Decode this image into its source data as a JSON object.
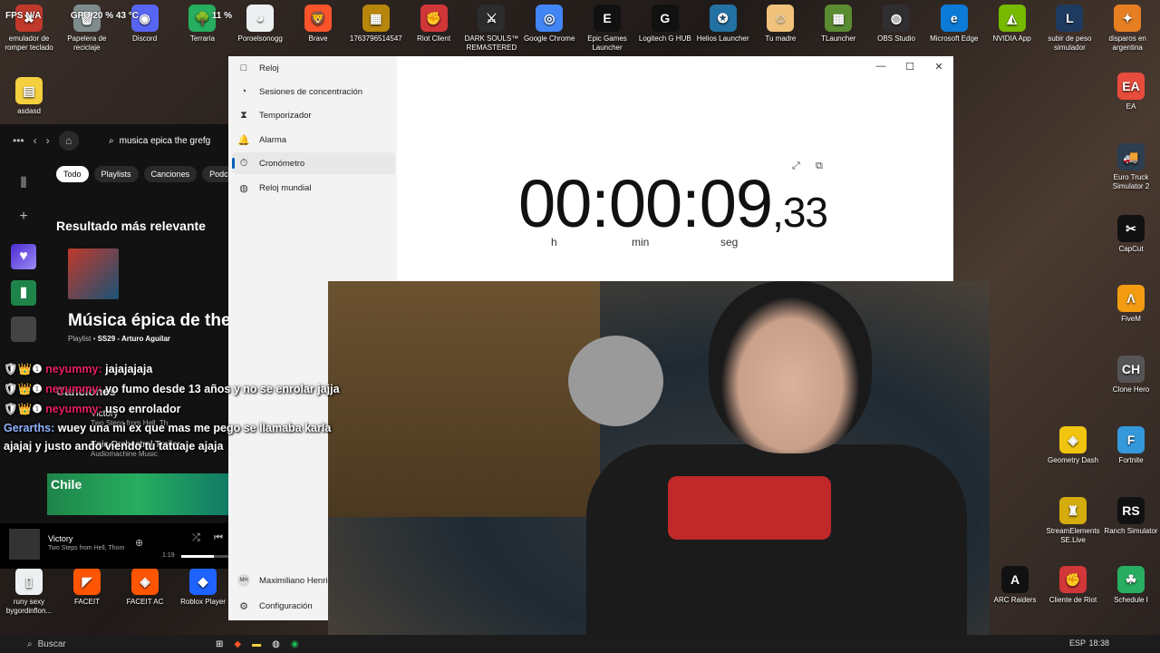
{
  "hud": {
    "fps": "FPS N/A",
    "gpu": "GPU",
    "gpu_load": "20 %",
    "gpu_temp": "43 °C",
    "extra": "11 %"
  },
  "desktop_top": [
    {
      "label": "emulador de romper teclado",
      "color": "#c0392b",
      "glyph": "✖"
    },
    {
      "label": "Papelera de reciclaje",
      "color": "#7f8c8d",
      "glyph": "🗑"
    },
    {
      "label": "Discord",
      "color": "#5865f2",
      "glyph": "◉"
    },
    {
      "label": "Terraria",
      "color": "#27ae60",
      "glyph": "🌳"
    },
    {
      "label": "Poroelsonogg",
      "color": "#ecf0f1",
      "glyph": "◕"
    },
    {
      "label": "Brave",
      "color": "#fb542b",
      "glyph": "🦁"
    },
    {
      "label": "1763796514547",
      "color": "#b8860b",
      "glyph": "▦"
    },
    {
      "label": "Riot Client",
      "color": "#d13639",
      "glyph": "✊"
    },
    {
      "label": "DARK SOULS™ REMASTERED",
      "color": "#2c2c2c",
      "glyph": "⚔"
    },
    {
      "label": "Google Chrome",
      "color": "#4285f4",
      "glyph": "◎"
    },
    {
      "label": "Epic Games Launcher",
      "color": "#111",
      "glyph": "E"
    },
    {
      "label": "Logitech G HUB",
      "color": "#111",
      "glyph": "G"
    },
    {
      "label": "Helios Launcher",
      "color": "#2471a3",
      "glyph": "✪"
    },
    {
      "label": "Tu madre",
      "color": "#f0c27b",
      "glyph": "☺"
    },
    {
      "label": "TLauncher",
      "color": "#5b8c32",
      "glyph": "▩"
    },
    {
      "label": "OBS Studio",
      "color": "#302e31",
      "glyph": "◍"
    },
    {
      "label": "Microsoft Edge",
      "color": "#0c7bd8",
      "glyph": "e"
    },
    {
      "label": "NVIDIA App",
      "color": "#76b900",
      "glyph": "◭"
    },
    {
      "label": "subir de peso simulador",
      "color": "#1f3a5f",
      "glyph": "L"
    },
    {
      "label": "disparos en argentina",
      "color": "#e67e22",
      "glyph": "✦"
    }
  ],
  "desktop_left": [
    {
      "label": "asdasd",
      "color": "#f4d03f",
      "glyph": "▤"
    }
  ],
  "desktop_right": [
    {
      "label": "EA",
      "color": "#e74c3c",
      "glyph": "EA"
    },
    {
      "label": "Euro Truck Simulator 2",
      "color": "#2c3e50",
      "glyph": "🚚"
    },
    {
      "label": "CapCut",
      "color": "#111",
      "glyph": "✂"
    },
    {
      "label": "FiveM",
      "color": "#f39c12",
      "glyph": "Λ"
    },
    {
      "label": "Clone Hero",
      "color": "#555",
      "glyph": "CH"
    },
    {
      "label": "Fortnite",
      "color": "#3498db",
      "glyph": "F"
    },
    {
      "label": "Geometry Dash",
      "color": "#f1c40f",
      "glyph": "◈"
    },
    {
      "label": "Ranch Simulator",
      "color": "#111",
      "glyph": "RS"
    },
    {
      "label": "StreamElements SE.Live",
      "color": "#d4ac0d",
      "glyph": "♜"
    },
    {
      "label": "Schedule I",
      "color": "#27ae60",
      "glyph": "☘"
    },
    {
      "label": "ARC Raiders",
      "color": "#111",
      "glyph": "A"
    },
    {
      "label": "Cliente de Riot",
      "color": "#d13639",
      "glyph": "✊"
    }
  ],
  "desktop_bottom": [
    {
      "label": "runy sexy bygordinflon...",
      "color": "#ecf0f1",
      "glyph": "▯"
    },
    {
      "label": "FACEIT",
      "color": "#ff5500",
      "glyph": "◤"
    },
    {
      "label": "FACEIT AC",
      "color": "#ff5500",
      "glyph": "◈"
    },
    {
      "label": "Roblox Player",
      "color": "#1e63ff",
      "glyph": "◆"
    }
  ],
  "spotify": {
    "search_value": "musica epica the grefg",
    "chips": [
      "Todo",
      "Playlists",
      "Canciones",
      "Podcast"
    ],
    "top_result_heading": "Resultado más relevante",
    "playlist_title": "Música épica de theg",
    "playlist_type": "Playlist",
    "playlist_owner": "SS29 - Arturo Aguilar",
    "songs_heading": "Canciones",
    "songs": [
      {
        "title": "Victory",
        "artist": "Two Steps from Hell, Th"
      },
      {
        "title": "Epic Orchestral Trailer",
        "artist": "Audiomachine Music"
      }
    ],
    "banner": "Chile",
    "now_playing_title": "Victory",
    "now_playing_artist": "Two Steps from Hell, Thom",
    "elapsed": "1:19"
  },
  "chat": [
    {
      "user": "neyummy:",
      "text": "jajajajaja"
    },
    {
      "user": "neyummy:",
      "text": "yo fumo desde 13 años y no se enrolar jajja"
    },
    {
      "user": "neyummy:",
      "text": "uso enrolador"
    },
    {
      "user": "Gerarths:",
      "text": "wuey una mi ex que mas me pego se llamaba karla ajajaj y justo ando viendo tu tatuaje ajaja"
    }
  ],
  "clock": {
    "nav": [
      {
        "label": "Reloj",
        "icon": "□"
      },
      {
        "label": "Sesiones de concentración",
        "icon": "◔"
      },
      {
        "label": "Temporizador",
        "icon": "⧗"
      },
      {
        "label": "Alarma",
        "icon": "🔔"
      },
      {
        "label": "Cronómetro",
        "icon": "⏱"
      },
      {
        "label": "Reloj mundial",
        "icon": "◍"
      }
    ],
    "user_initials": "MH",
    "user_name": "Maximiliano Henriq",
    "settings": "Configuración",
    "time": "00:00:09",
    "centis": ",33",
    "unit_h": "h",
    "unit_min": "min",
    "unit_seg": "seg",
    "win_min": "—",
    "win_max": "☐",
    "win_close": "✕"
  },
  "taskbar": {
    "search": "Buscar",
    "lang": "ESP",
    "time": "18:38"
  }
}
